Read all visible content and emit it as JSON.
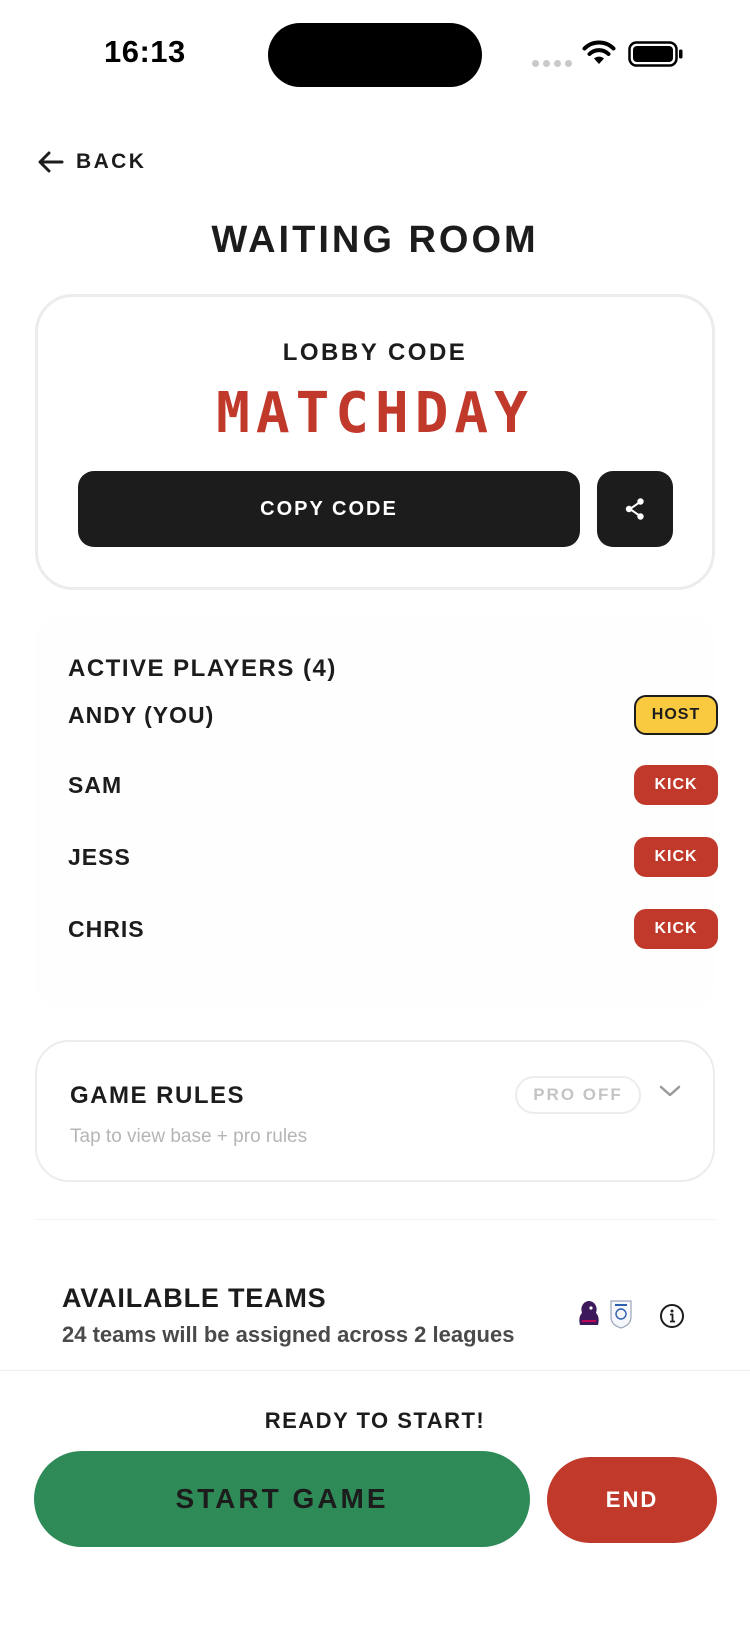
{
  "status_bar": {
    "time": "16:13"
  },
  "header": {
    "back_label": "BACK",
    "title": "WAITING ROOM"
  },
  "lobby": {
    "label": "LOBBY CODE",
    "code": "MATCHDAY",
    "copy_label": "COPY CODE"
  },
  "players": {
    "title": "ACTIVE PLAYERS (4)",
    "list": [
      {
        "name": "ANDY (YOU)",
        "badge": "HOST"
      },
      {
        "name": "SAM",
        "badge": "KICK"
      },
      {
        "name": "JESS",
        "badge": "KICK"
      },
      {
        "name": "CHRIS",
        "badge": "KICK"
      }
    ]
  },
  "rules": {
    "title": "GAME RULES",
    "subtitle": "Tap to view base + pro rules",
    "pro_status": "PRO OFF"
  },
  "teams": {
    "title": "AVAILABLE TEAMS",
    "subtitle": "24 teams will be assigned across 2 leagues"
  },
  "footer": {
    "status": "READY TO START!",
    "start_label": "START GAME",
    "end_label": "END"
  },
  "colors": {
    "accent_red": "#c0392b",
    "start_green": "#2e8b57",
    "host_yellow": "#f9c940",
    "dark": "#1c1c1c"
  },
  "icons": {
    "back": "arrow-left-icon",
    "share": "share-icon",
    "chevron": "chevron-down-icon",
    "info": "info-icon",
    "leagues": [
      "premier-league-logo-icon",
      "efl-logo-icon"
    ]
  }
}
